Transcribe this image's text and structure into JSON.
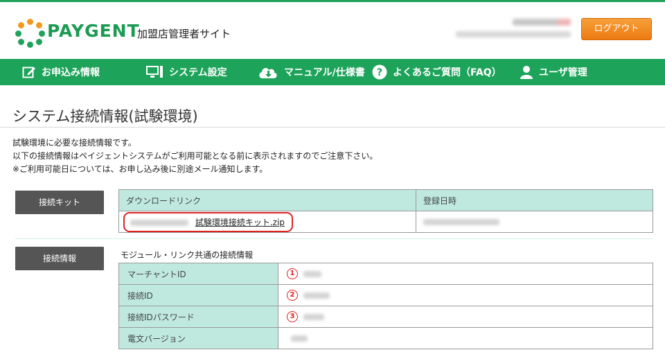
{
  "header": {
    "brand": "PAYGENT",
    "subtitle": "加盟店管理者サイト",
    "logout_label": "ログアウト"
  },
  "nav": {
    "items": [
      {
        "label": "お申込み情報",
        "icon": "edit-icon"
      },
      {
        "label": "システム設定",
        "icon": "monitor-icon"
      },
      {
        "label": "マニュアル/仕様書",
        "icon": "cloud-download-icon"
      },
      {
        "label": "よくあるご質問（FAQ）",
        "icon": "question-icon"
      },
      {
        "label": "ユーザ管理",
        "icon": "user-icon"
      }
    ]
  },
  "page": {
    "title": "システム接続情報(試験環境)",
    "description": [
      "試験環境に必要な接続情報です。",
      "以下の接続情報はペイジェントシステムがご利用可能となる前に表示されますのでご注意下さい。",
      "※ご利用可能日については、お申し込み後に別途メール通知します。"
    ]
  },
  "kit": {
    "label": "接続キット",
    "header_download": "ダウンロードリンク",
    "header_date": "登録日時",
    "download_link": "試験環境接続キット.zip"
  },
  "connection": {
    "label": "接続情報",
    "heading": "モジュール・リンク共通の接続情報",
    "rows": [
      {
        "key": "マーチャントID",
        "badge": "1"
      },
      {
        "key": "接続ID",
        "badge": "2"
      },
      {
        "key": "接続IDパスワード",
        "badge": "3"
      },
      {
        "key": "電文バージョン",
        "badge": ""
      }
    ]
  },
  "colors": {
    "brand_green": "#1ea35a",
    "logout_orange": "#ec7a12",
    "table_header": "#bfe9df",
    "highlight_red": "#dd2222"
  }
}
